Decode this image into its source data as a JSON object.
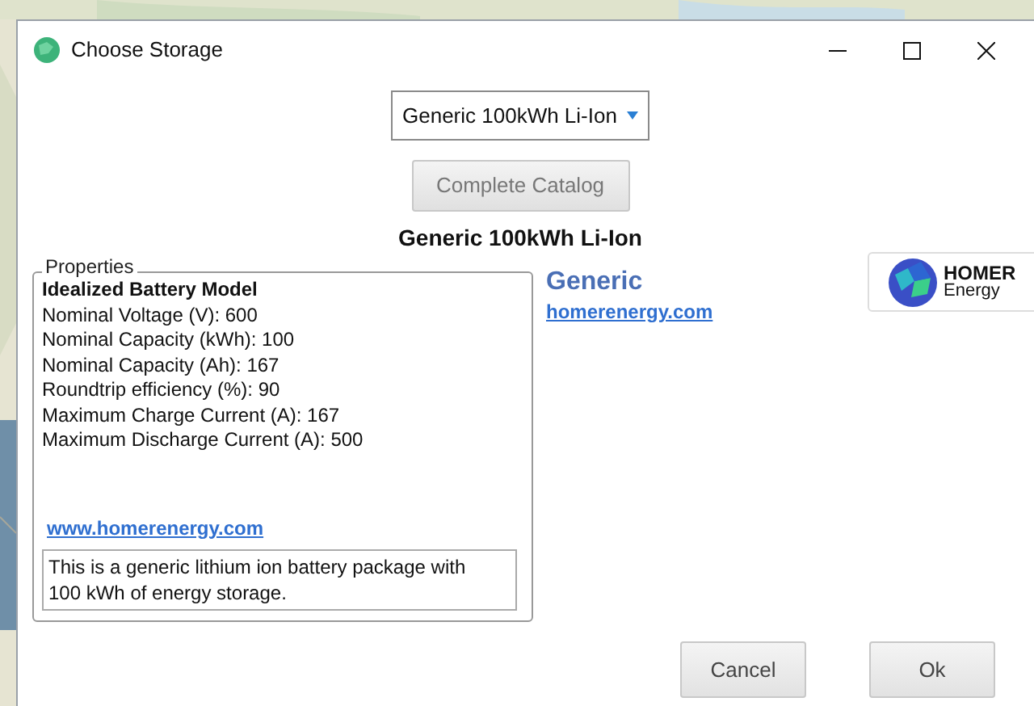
{
  "window": {
    "title": "Choose Storage"
  },
  "dropdown": {
    "value": "Generic 100kWh Li-Ion"
  },
  "catalog_button": {
    "label": "Complete Catalog",
    "disabled": true
  },
  "heading": "Generic 100kWh Li-Ion",
  "properties": {
    "legend": "Properties",
    "model": "Idealized Battery Model",
    "lines": [
      "Nominal Voltage (V): 600",
      "Nominal Capacity (kWh): 100",
      "Nominal Capacity (Ah): 167",
      "Roundtrip efficiency (%): 90",
      "Maximum Charge Current (A): 167",
      "Maximum Discharge Current (A): 500"
    ],
    "link": "www.homerenergy.com",
    "description": "This is a generic lithium ion battery package with 100 kWh of energy storage."
  },
  "manufacturer": {
    "name": "Generic",
    "link": "homerenergy.com",
    "logo_lines": [
      "HOMER",
      "Energy"
    ]
  },
  "buttons": [
    "Cancel",
    "Ok"
  ]
}
